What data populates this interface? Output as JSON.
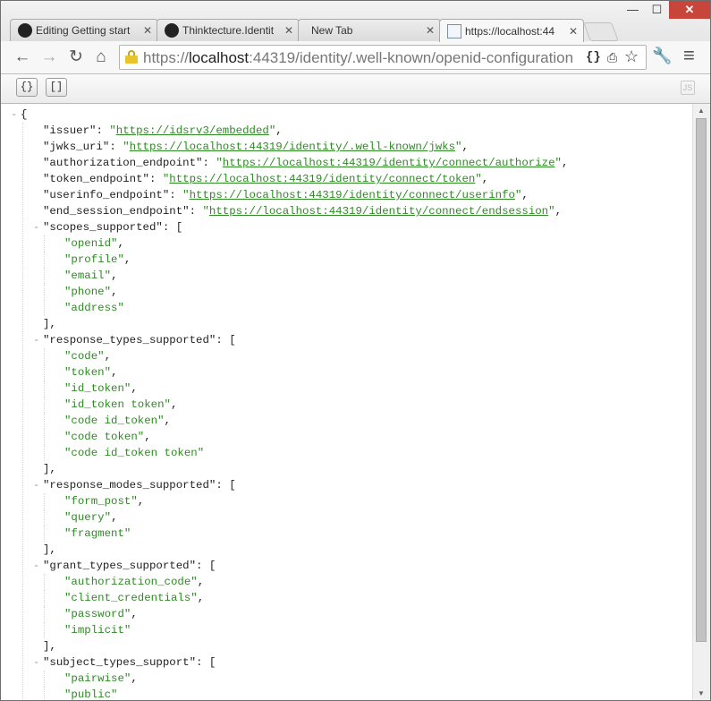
{
  "tabs": [
    {
      "title": "Editing Getting start",
      "icon": "github-icon"
    },
    {
      "title": "Thinktecture.Identit",
      "icon": "github-icon"
    },
    {
      "title": "New Tab",
      "icon": ""
    },
    {
      "title": "https://localhost:44",
      "icon": "document-icon"
    }
  ],
  "window_controls": {
    "minimize": "—",
    "maximize": "☐",
    "close": "✕"
  },
  "nav": {
    "back": "←",
    "forward": "→",
    "reload": "↻",
    "home": "⌂"
  },
  "address": {
    "prefix": "https://",
    "host": "localhost",
    "rest": ":44319/identity/.well-known/openid-configuration"
  },
  "omni_icons": {
    "json": "{}",
    "page": "⎙",
    "star": "☆"
  },
  "toolbar_right": {
    "wrench": "🔧",
    "menu": "≡"
  },
  "viewer": {
    "btn_objects": "{}",
    "btn_arrays": "[]",
    "logo": "JS"
  },
  "json_lines": [
    {
      "indent": 0,
      "toggle": "-",
      "parts": [
        {
          "t": "{",
          "c": "key"
        }
      ]
    },
    {
      "indent": 1,
      "toggle": "",
      "parts": [
        {
          "t": "\"issuer\": ",
          "c": "key"
        },
        {
          "t": "\"",
          "c": "str"
        },
        {
          "t": "https://idsrv3/embedded",
          "c": "link"
        },
        {
          "t": "\"",
          "c": "str"
        },
        {
          "t": ",",
          "c": "key"
        }
      ]
    },
    {
      "indent": 1,
      "toggle": "",
      "parts": [
        {
          "t": "\"jwks_uri\": ",
          "c": "key"
        },
        {
          "t": "\"",
          "c": "str"
        },
        {
          "t": "https://localhost:44319/identity/.well-known/jwks",
          "c": "link"
        },
        {
          "t": "\"",
          "c": "str"
        },
        {
          "t": ",",
          "c": "key"
        }
      ]
    },
    {
      "indent": 1,
      "toggle": "",
      "parts": [
        {
          "t": "\"authorization_endpoint\": ",
          "c": "key"
        },
        {
          "t": "\"",
          "c": "str"
        },
        {
          "t": "https://localhost:44319/identity/connect/authorize",
          "c": "link"
        },
        {
          "t": "\"",
          "c": "str"
        },
        {
          "t": ",",
          "c": "key"
        }
      ]
    },
    {
      "indent": 1,
      "toggle": "",
      "parts": [
        {
          "t": "\"token_endpoint\": ",
          "c": "key"
        },
        {
          "t": "\"",
          "c": "str"
        },
        {
          "t": "https://localhost:44319/identity/connect/token",
          "c": "link"
        },
        {
          "t": "\"",
          "c": "str"
        },
        {
          "t": ",",
          "c": "key"
        }
      ]
    },
    {
      "indent": 1,
      "toggle": "",
      "parts": [
        {
          "t": "\"userinfo_endpoint\": ",
          "c": "key"
        },
        {
          "t": "\"",
          "c": "str"
        },
        {
          "t": "https://localhost:44319/identity/connect/userinfo",
          "c": "link"
        },
        {
          "t": "\"",
          "c": "str"
        },
        {
          "t": ",",
          "c": "key"
        }
      ]
    },
    {
      "indent": 1,
      "toggle": "",
      "parts": [
        {
          "t": "\"end_session_endpoint\": ",
          "c": "key"
        },
        {
          "t": "\"",
          "c": "str"
        },
        {
          "t": "https://localhost:44319/identity/connect/endsession",
          "c": "link"
        },
        {
          "t": "\"",
          "c": "str"
        },
        {
          "t": ",",
          "c": "key"
        }
      ]
    },
    {
      "indent": 1,
      "toggle": "-",
      "parts": [
        {
          "t": "\"scopes_supported\": [",
          "c": "key"
        }
      ]
    },
    {
      "indent": 2,
      "toggle": "",
      "parts": [
        {
          "t": "\"openid\"",
          "c": "str"
        },
        {
          "t": ",",
          "c": "key"
        }
      ]
    },
    {
      "indent": 2,
      "toggle": "",
      "parts": [
        {
          "t": "\"profile\"",
          "c": "str"
        },
        {
          "t": ",",
          "c": "key"
        }
      ]
    },
    {
      "indent": 2,
      "toggle": "",
      "parts": [
        {
          "t": "\"email\"",
          "c": "str"
        },
        {
          "t": ",",
          "c": "key"
        }
      ]
    },
    {
      "indent": 2,
      "toggle": "",
      "parts": [
        {
          "t": "\"phone\"",
          "c": "str"
        },
        {
          "t": ",",
          "c": "key"
        }
      ]
    },
    {
      "indent": 2,
      "toggle": "",
      "parts": [
        {
          "t": "\"address\"",
          "c": "str"
        }
      ]
    },
    {
      "indent": 1,
      "toggle": "",
      "parts": [
        {
          "t": "],",
          "c": "key"
        }
      ]
    },
    {
      "indent": 1,
      "toggle": "-",
      "parts": [
        {
          "t": "\"response_types_supported\": [",
          "c": "key"
        }
      ]
    },
    {
      "indent": 2,
      "toggle": "",
      "parts": [
        {
          "t": "\"code\"",
          "c": "str"
        },
        {
          "t": ",",
          "c": "key"
        }
      ]
    },
    {
      "indent": 2,
      "toggle": "",
      "parts": [
        {
          "t": "\"token\"",
          "c": "str"
        },
        {
          "t": ",",
          "c": "key"
        }
      ]
    },
    {
      "indent": 2,
      "toggle": "",
      "parts": [
        {
          "t": "\"id_token\"",
          "c": "str"
        },
        {
          "t": ",",
          "c": "key"
        }
      ]
    },
    {
      "indent": 2,
      "toggle": "",
      "parts": [
        {
          "t": "\"id_token token\"",
          "c": "str"
        },
        {
          "t": ",",
          "c": "key"
        }
      ]
    },
    {
      "indent": 2,
      "toggle": "",
      "parts": [
        {
          "t": "\"code id_token\"",
          "c": "str"
        },
        {
          "t": ",",
          "c": "key"
        }
      ]
    },
    {
      "indent": 2,
      "toggle": "",
      "parts": [
        {
          "t": "\"code token\"",
          "c": "str"
        },
        {
          "t": ",",
          "c": "key"
        }
      ]
    },
    {
      "indent": 2,
      "toggle": "",
      "parts": [
        {
          "t": "\"code id_token token\"",
          "c": "str"
        }
      ]
    },
    {
      "indent": 1,
      "toggle": "",
      "parts": [
        {
          "t": "],",
          "c": "key"
        }
      ]
    },
    {
      "indent": 1,
      "toggle": "-",
      "parts": [
        {
          "t": "\"response_modes_supported\": [",
          "c": "key"
        }
      ]
    },
    {
      "indent": 2,
      "toggle": "",
      "parts": [
        {
          "t": "\"form_post\"",
          "c": "str"
        },
        {
          "t": ",",
          "c": "key"
        }
      ]
    },
    {
      "indent": 2,
      "toggle": "",
      "parts": [
        {
          "t": "\"query\"",
          "c": "str"
        },
        {
          "t": ",",
          "c": "key"
        }
      ]
    },
    {
      "indent": 2,
      "toggle": "",
      "parts": [
        {
          "t": "\"fragment\"",
          "c": "str"
        }
      ]
    },
    {
      "indent": 1,
      "toggle": "",
      "parts": [
        {
          "t": "],",
          "c": "key"
        }
      ]
    },
    {
      "indent": 1,
      "toggle": "-",
      "parts": [
        {
          "t": "\"grant_types_supported\": [",
          "c": "key"
        }
      ]
    },
    {
      "indent": 2,
      "toggle": "",
      "parts": [
        {
          "t": "\"authorization_code\"",
          "c": "str"
        },
        {
          "t": ",",
          "c": "key"
        }
      ]
    },
    {
      "indent": 2,
      "toggle": "",
      "parts": [
        {
          "t": "\"client_credentials\"",
          "c": "str"
        },
        {
          "t": ",",
          "c": "key"
        }
      ]
    },
    {
      "indent": 2,
      "toggle": "",
      "parts": [
        {
          "t": "\"password\"",
          "c": "str"
        },
        {
          "t": ",",
          "c": "key"
        }
      ]
    },
    {
      "indent": 2,
      "toggle": "",
      "parts": [
        {
          "t": "\"implicit\"",
          "c": "str"
        }
      ]
    },
    {
      "indent": 1,
      "toggle": "",
      "parts": [
        {
          "t": "],",
          "c": "key"
        }
      ]
    },
    {
      "indent": 1,
      "toggle": "-",
      "parts": [
        {
          "t": "\"subject_types_support\": [",
          "c": "key"
        }
      ]
    },
    {
      "indent": 2,
      "toggle": "",
      "parts": [
        {
          "t": "\"pairwise\"",
          "c": "str"
        },
        {
          "t": ",",
          "c": "key"
        }
      ]
    },
    {
      "indent": 2,
      "toggle": "",
      "parts": [
        {
          "t": "\"public\"",
          "c": "str"
        }
      ]
    }
  ]
}
